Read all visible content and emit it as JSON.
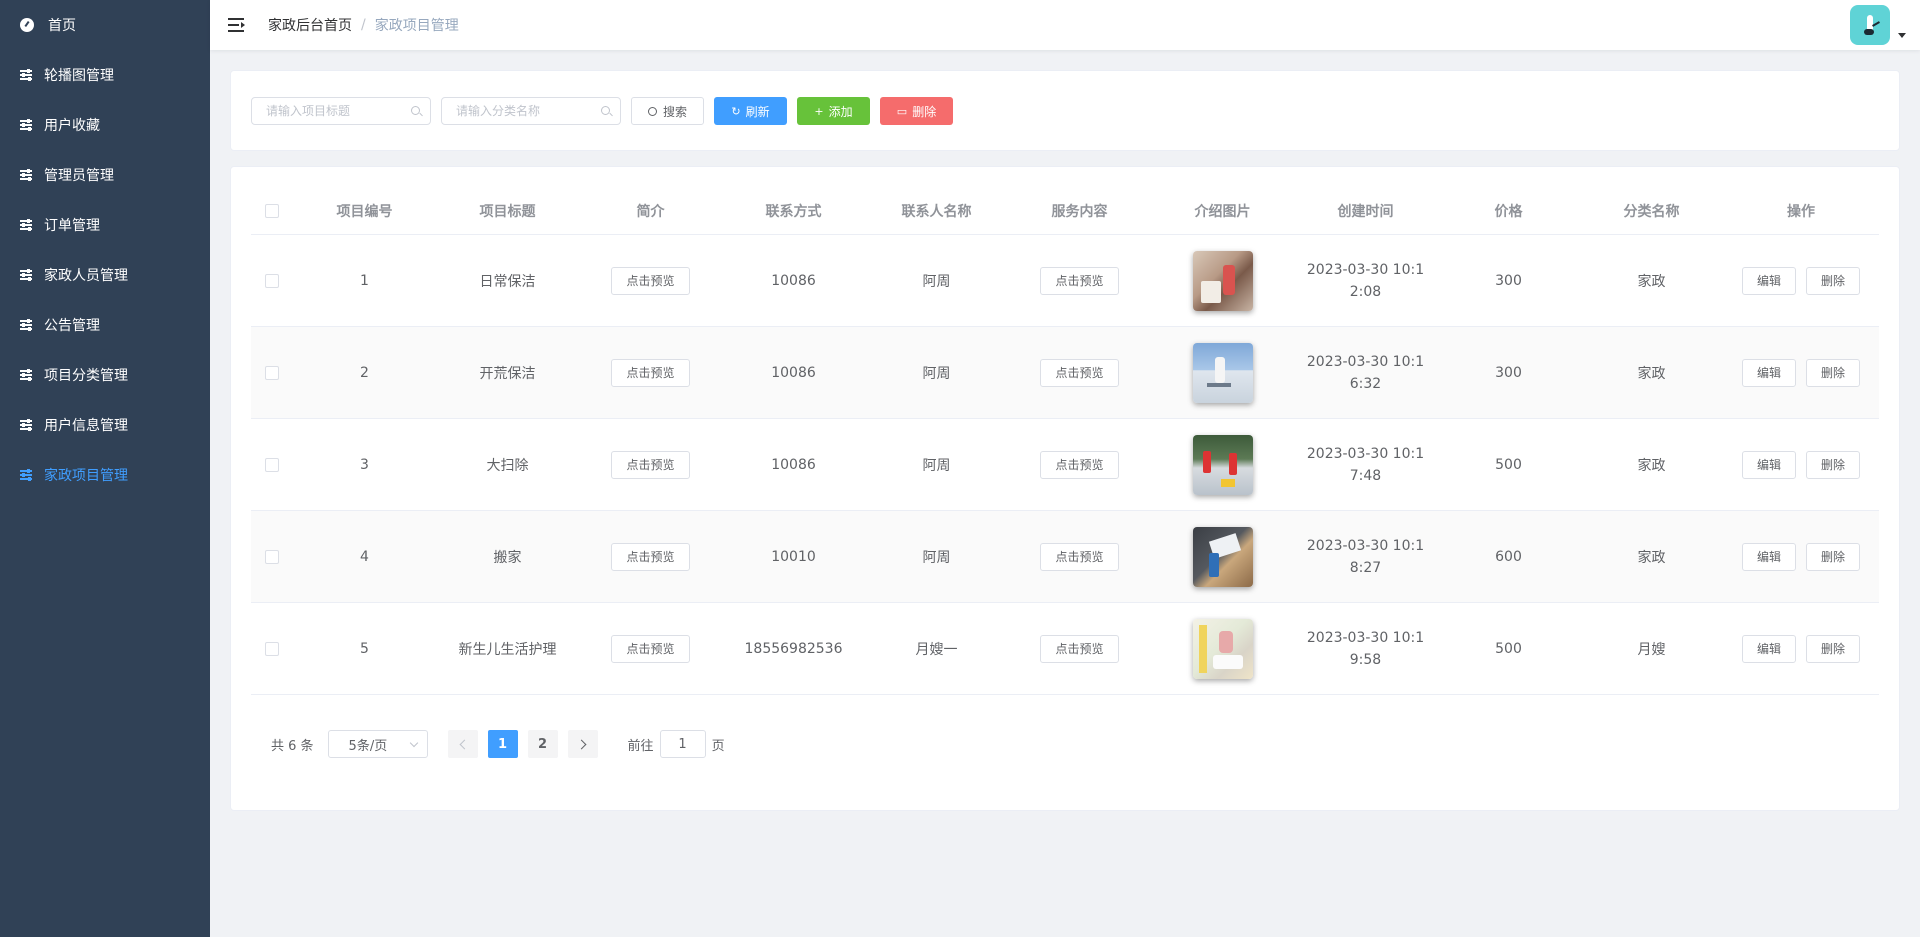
{
  "sidebar": {
    "items": [
      {
        "label": "首页",
        "icon": "dashboard-icon"
      },
      {
        "label": "轮播图管理",
        "icon": "sliders-icon"
      },
      {
        "label": "用户收藏",
        "icon": "sliders-icon"
      },
      {
        "label": "管理员管理",
        "icon": "sliders-icon"
      },
      {
        "label": "订单管理",
        "icon": "sliders-icon"
      },
      {
        "label": "家政人员管理",
        "icon": "sliders-icon"
      },
      {
        "label": "公告管理",
        "icon": "sliders-icon"
      },
      {
        "label": "项目分类管理",
        "icon": "sliders-icon"
      },
      {
        "label": "用户信息管理",
        "icon": "sliders-icon"
      },
      {
        "label": "家政项目管理",
        "icon": "sliders-icon",
        "active": true
      }
    ],
    "background": "#304156",
    "active_color": "#409eff"
  },
  "header": {
    "breadcrumb_home": "家政后台首页",
    "breadcrumb_sep": "/",
    "breadcrumb_current": "家政项目管理"
  },
  "search": {
    "title_placeholder": "请输入项目标题",
    "category_placeholder": "请输入分类名称",
    "search_label": "搜索",
    "refresh_label": "刷新",
    "add_label": "添加",
    "delete_label": "删除"
  },
  "table": {
    "columns": [
      "项目编号",
      "项目标题",
      "简介",
      "联系方式",
      "联系人名称",
      "服务内容",
      "介绍图片",
      "创建时间",
      "价格",
      "分类名称",
      "操作"
    ],
    "preview_label": "点击预览",
    "edit_label": "编辑",
    "delete_label": "删除",
    "rows": [
      {
        "id": "1",
        "title": "日常保洁",
        "contact": "10086",
        "contact_name": "阿周",
        "created": "2023-03-30 10:12:08",
        "price": "300",
        "category": "家政"
      },
      {
        "id": "2",
        "title": "开荒保洁",
        "contact": "10086",
        "contact_name": "阿周",
        "created": "2023-03-30 10:16:32",
        "price": "300",
        "category": "家政"
      },
      {
        "id": "3",
        "title": "大扫除",
        "contact": "10086",
        "contact_name": "阿周",
        "created": "2023-03-30 10:17:48",
        "price": "500",
        "category": "家政"
      },
      {
        "id": "4",
        "title": "搬家",
        "contact": "10010",
        "contact_name": "阿周",
        "created": "2023-03-30 10:18:27",
        "price": "600",
        "category": "家政"
      },
      {
        "id": "5",
        "title": "新生儿生活护理",
        "contact": "18556982536",
        "contact_name": "月嫂一",
        "created": "2023-03-30 10:19:58",
        "price": "500",
        "category": "月嫂"
      }
    ]
  },
  "pagination": {
    "total_text": "共 6 条",
    "page_size": "5条/页",
    "pages": [
      "1",
      "2"
    ],
    "current_page": "1",
    "goto_label": "前往",
    "goto_value": "1",
    "page_suffix": "页"
  }
}
